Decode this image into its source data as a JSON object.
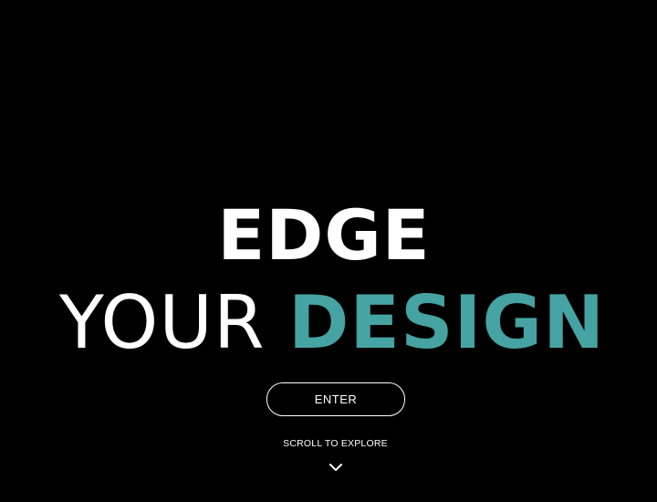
{
  "hero": {
    "headline_line1": "EDGE",
    "headline_word_light": "YOUR",
    "headline_word_accent": "DESIGN",
    "enter_label": "ENTER",
    "scroll_label": "SCROLL TO EXPLORE",
    "scroll_icon": "chevron-down-icon"
  },
  "colors": {
    "background": "#000000",
    "text": "#ffffff",
    "accent": "#46a3a3"
  }
}
